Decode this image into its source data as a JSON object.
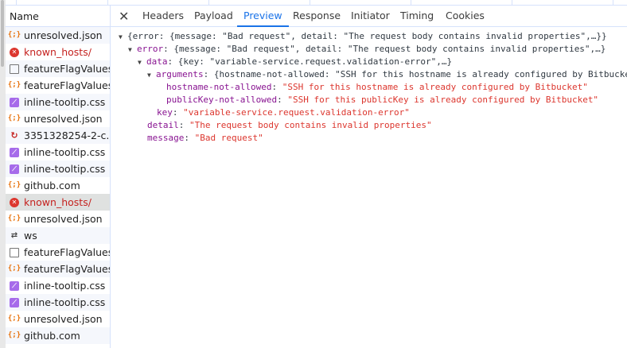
{
  "name_header": "Name",
  "requests": [
    {
      "name": "unresolved.json",
      "icon": "json"
    },
    {
      "name": "known_hosts/",
      "icon": "error"
    },
    {
      "name": "featureFlagValues",
      "icon": "doc"
    },
    {
      "name": "featureFlagValues",
      "icon": "json"
    },
    {
      "name": "inline-tooltip.css",
      "icon": "css"
    },
    {
      "name": "unresolved.json",
      "icon": "json"
    },
    {
      "name": "3351328254-2-c...",
      "icon": "img"
    },
    {
      "name": "inline-tooltip.css",
      "icon": "css"
    },
    {
      "name": "inline-tooltip.css",
      "icon": "css"
    },
    {
      "name": "github.com",
      "icon": "json"
    },
    {
      "name": "known_hosts/",
      "icon": "error",
      "selected": true
    },
    {
      "name": "unresolved.json",
      "icon": "json"
    },
    {
      "name": "ws",
      "icon": "ws"
    },
    {
      "name": "featureFlagValues",
      "icon": "doc"
    },
    {
      "name": "featureFlagValues",
      "icon": "json"
    },
    {
      "name": "inline-tooltip.css",
      "icon": "css"
    },
    {
      "name": "inline-tooltip.css",
      "icon": "css"
    },
    {
      "name": "unresolved.json",
      "icon": "json"
    },
    {
      "name": "github.com",
      "icon": "json"
    }
  ],
  "tabs": [
    "Headers",
    "Payload",
    "Preview",
    "Response",
    "Initiator",
    "Timing",
    "Cookies"
  ],
  "active_tab": "Preview",
  "preview": {
    "root": "{error: {message: \"Bad request\", detail: \"The request body contains invalid properties\",…}}",
    "error_key": "error",
    "error_summary": "{message: \"Bad request\", detail: \"The request body contains invalid properties\",…}",
    "data_key": "data",
    "data_summary": "{key: \"variable-service.request.validation-error\",…}",
    "arguments_key": "arguments",
    "arguments_summary": "{hostname-not-allowed: \"SSH for this hostname is already configured by Bitbucket\",…}",
    "hostname_key": "hostname-not-allowed",
    "hostname_val": "\"SSH for this hostname is already configured by Bitbucket\"",
    "publickey_key": "publicKey-not-allowed",
    "publickey_val": "\"SSH for this publicKey is already configured by Bitbucket\"",
    "key_key": "key",
    "key_val": "\"variable-service.request.validation-error\"",
    "detail_key": "detail",
    "detail_val": "\"The request body contains invalid properties\"",
    "message_key": "message",
    "message_val": "\"Bad request\""
  }
}
